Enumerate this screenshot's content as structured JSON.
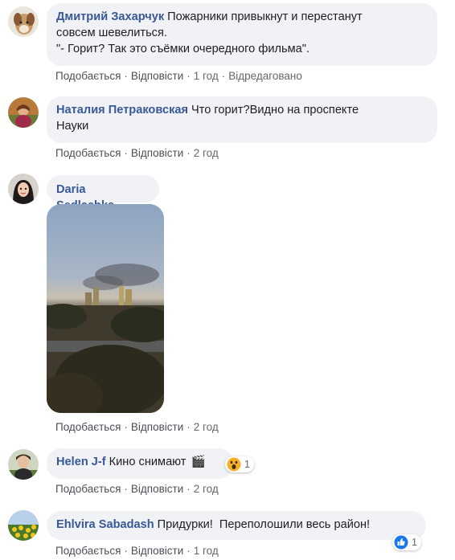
{
  "comments": [
    {
      "author": "Дмитрий Захарчук",
      "line1": "Пожарники привыкнут и перестанут",
      "line2": "совсем шевелиться.",
      "line3": "\"- Горит? Так это съёмки очередного фильма\".",
      "like": "Подобається",
      "reply": "Відповісти",
      "time": "1 год",
      "edited": "Відредаговано"
    },
    {
      "author": "Наталия Петраковская",
      "line1": "Что горит?Видно на проспекте",
      "line2": "Науки",
      "like": "Подобається",
      "reply": "Відповісти",
      "time": "2 год"
    },
    {
      "author": "Daria Sedlachka",
      "like": "Подобається",
      "reply": "Відповісти",
      "time": "2 год"
    },
    {
      "author": "Helen J-f",
      "text": "Кино снимают",
      "emoji": "🎬",
      "reaction_count": "1",
      "reaction_icon": "wow-icon",
      "like": "Подобається",
      "reply": "Відповісти",
      "time": "2 год"
    },
    {
      "author": "Ehlvira Sabadash",
      "text": "Придурки!  Переполошили весь район!",
      "reaction_count": "1",
      "reaction_icon": "like-icon",
      "like": "Подобається",
      "reply": "Відповісти",
      "time": "1 год"
    }
  ],
  "colors": {
    "author": "#385898",
    "bubble": "#f0f2f5",
    "meta": "#65676b",
    "like_blue": "#1877f2",
    "wow_yellow": "#f7b125"
  }
}
